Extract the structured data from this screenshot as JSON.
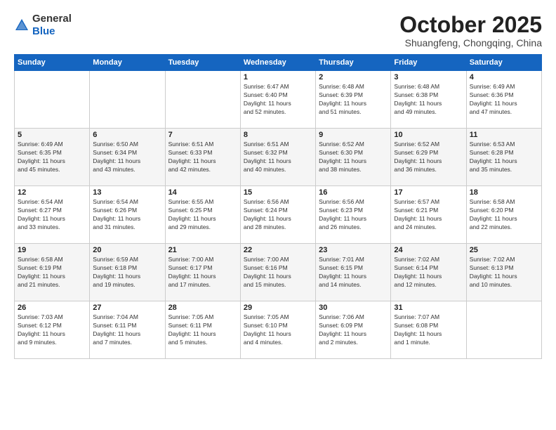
{
  "header": {
    "logo_general": "General",
    "logo_blue": "Blue",
    "month_title": "October 2025",
    "subtitle": "Shuangfeng, Chongqing, China"
  },
  "days_of_week": [
    "Sunday",
    "Monday",
    "Tuesday",
    "Wednesday",
    "Thursday",
    "Friday",
    "Saturday"
  ],
  "weeks": [
    [
      {
        "day": "",
        "info": ""
      },
      {
        "day": "",
        "info": ""
      },
      {
        "day": "",
        "info": ""
      },
      {
        "day": "1",
        "info": "Sunrise: 6:47 AM\nSunset: 6:40 PM\nDaylight: 11 hours\nand 52 minutes."
      },
      {
        "day": "2",
        "info": "Sunrise: 6:48 AM\nSunset: 6:39 PM\nDaylight: 11 hours\nand 51 minutes."
      },
      {
        "day": "3",
        "info": "Sunrise: 6:48 AM\nSunset: 6:38 PM\nDaylight: 11 hours\nand 49 minutes."
      },
      {
        "day": "4",
        "info": "Sunrise: 6:49 AM\nSunset: 6:36 PM\nDaylight: 11 hours\nand 47 minutes."
      }
    ],
    [
      {
        "day": "5",
        "info": "Sunrise: 6:49 AM\nSunset: 6:35 PM\nDaylight: 11 hours\nand 45 minutes."
      },
      {
        "day": "6",
        "info": "Sunrise: 6:50 AM\nSunset: 6:34 PM\nDaylight: 11 hours\nand 43 minutes."
      },
      {
        "day": "7",
        "info": "Sunrise: 6:51 AM\nSunset: 6:33 PM\nDaylight: 11 hours\nand 42 minutes."
      },
      {
        "day": "8",
        "info": "Sunrise: 6:51 AM\nSunset: 6:32 PM\nDaylight: 11 hours\nand 40 minutes."
      },
      {
        "day": "9",
        "info": "Sunrise: 6:52 AM\nSunset: 6:30 PM\nDaylight: 11 hours\nand 38 minutes."
      },
      {
        "day": "10",
        "info": "Sunrise: 6:52 AM\nSunset: 6:29 PM\nDaylight: 11 hours\nand 36 minutes."
      },
      {
        "day": "11",
        "info": "Sunrise: 6:53 AM\nSunset: 6:28 PM\nDaylight: 11 hours\nand 35 minutes."
      }
    ],
    [
      {
        "day": "12",
        "info": "Sunrise: 6:54 AM\nSunset: 6:27 PM\nDaylight: 11 hours\nand 33 minutes."
      },
      {
        "day": "13",
        "info": "Sunrise: 6:54 AM\nSunset: 6:26 PM\nDaylight: 11 hours\nand 31 minutes."
      },
      {
        "day": "14",
        "info": "Sunrise: 6:55 AM\nSunset: 6:25 PM\nDaylight: 11 hours\nand 29 minutes."
      },
      {
        "day": "15",
        "info": "Sunrise: 6:56 AM\nSunset: 6:24 PM\nDaylight: 11 hours\nand 28 minutes."
      },
      {
        "day": "16",
        "info": "Sunrise: 6:56 AM\nSunset: 6:23 PM\nDaylight: 11 hours\nand 26 minutes."
      },
      {
        "day": "17",
        "info": "Sunrise: 6:57 AM\nSunset: 6:21 PM\nDaylight: 11 hours\nand 24 minutes."
      },
      {
        "day": "18",
        "info": "Sunrise: 6:58 AM\nSunset: 6:20 PM\nDaylight: 11 hours\nand 22 minutes."
      }
    ],
    [
      {
        "day": "19",
        "info": "Sunrise: 6:58 AM\nSunset: 6:19 PM\nDaylight: 11 hours\nand 21 minutes."
      },
      {
        "day": "20",
        "info": "Sunrise: 6:59 AM\nSunset: 6:18 PM\nDaylight: 11 hours\nand 19 minutes."
      },
      {
        "day": "21",
        "info": "Sunrise: 7:00 AM\nSunset: 6:17 PM\nDaylight: 11 hours\nand 17 minutes."
      },
      {
        "day": "22",
        "info": "Sunrise: 7:00 AM\nSunset: 6:16 PM\nDaylight: 11 hours\nand 15 minutes."
      },
      {
        "day": "23",
        "info": "Sunrise: 7:01 AM\nSunset: 6:15 PM\nDaylight: 11 hours\nand 14 minutes."
      },
      {
        "day": "24",
        "info": "Sunrise: 7:02 AM\nSunset: 6:14 PM\nDaylight: 11 hours\nand 12 minutes."
      },
      {
        "day": "25",
        "info": "Sunrise: 7:02 AM\nSunset: 6:13 PM\nDaylight: 11 hours\nand 10 minutes."
      }
    ],
    [
      {
        "day": "26",
        "info": "Sunrise: 7:03 AM\nSunset: 6:12 PM\nDaylight: 11 hours\nand 9 minutes."
      },
      {
        "day": "27",
        "info": "Sunrise: 7:04 AM\nSunset: 6:11 PM\nDaylight: 11 hours\nand 7 minutes."
      },
      {
        "day": "28",
        "info": "Sunrise: 7:05 AM\nSunset: 6:11 PM\nDaylight: 11 hours\nand 5 minutes."
      },
      {
        "day": "29",
        "info": "Sunrise: 7:05 AM\nSunset: 6:10 PM\nDaylight: 11 hours\nand 4 minutes."
      },
      {
        "day": "30",
        "info": "Sunrise: 7:06 AM\nSunset: 6:09 PM\nDaylight: 11 hours\nand 2 minutes."
      },
      {
        "day": "31",
        "info": "Sunrise: 7:07 AM\nSunset: 6:08 PM\nDaylight: 11 hours\nand 1 minute."
      },
      {
        "day": "",
        "info": ""
      }
    ]
  ]
}
